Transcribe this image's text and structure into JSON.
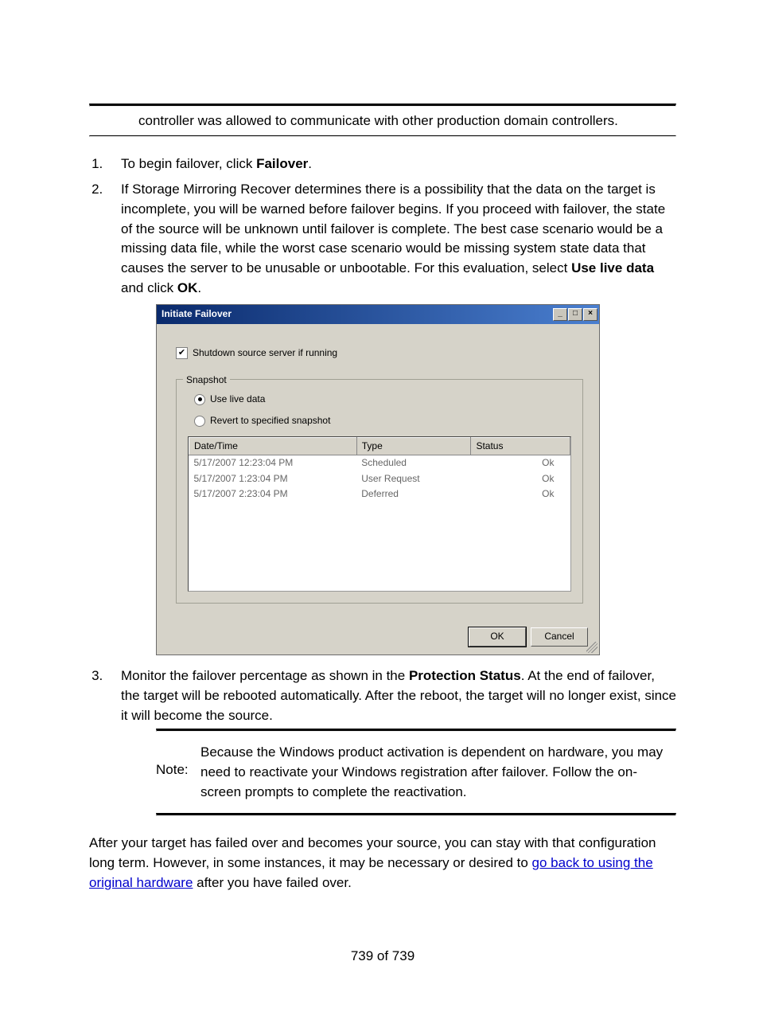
{
  "intro": "controller was allowed to communicate with other production domain controllers.",
  "steps": {
    "s1_a": "To begin failover, click ",
    "s1_bold": "Failover",
    "s1_b": ".",
    "s2_a": "If Storage Mirroring Recover determines there is a possibility that the data on the target is incomplete, you will be warned before failover begins. If you proceed with failover, the state of the source will be unknown until failover is complete. The best case scenario would be a missing data file, while the worst case scenario would be missing system state data that causes the server to be unusable or unbootable. For this evaluation, select ",
    "s2_bold1": "Use live data",
    "s2_mid": " and click ",
    "s2_bold2": "OK",
    "s2_b": ".",
    "s3_a": "Monitor the failover percentage as shown in the ",
    "s3_bold": "Protection Status",
    "s3_b": ". At the end of failover, the target will be rebooted automatically. After the reboot, the target will no longer exist, since it will become the source."
  },
  "dialog": {
    "title": "Initiate Failover",
    "min": "_",
    "max": "□",
    "close": "×",
    "shutdown": "Shutdown source server if running",
    "snapshot_legend": "Snapshot",
    "use_live": "Use live data",
    "revert": "Revert to specified snapshot",
    "cols": {
      "dt": "Date/Time",
      "type": "Type",
      "status": "Status"
    },
    "rows": [
      {
        "dt": "5/17/2007 12:23:04 PM",
        "type": "Scheduled",
        "status": "Ok"
      },
      {
        "dt": "5/17/2007 1:23:04 PM",
        "type": "User Request",
        "status": "Ok"
      },
      {
        "dt": "5/17/2007 2:23:04 PM",
        "type": "Deferred",
        "status": "Ok"
      }
    ],
    "ok": "OK",
    "cancel": "Cancel"
  },
  "note": {
    "label": "Note:",
    "text": "Because the Windows product activation is dependent on hardware, you may need to reactivate your Windows registration after failover. Follow the on-screen prompts to complete the reactivation."
  },
  "after": {
    "a": "After your target has failed over and becomes your source, you can stay with that configuration long term. However, in some instances, it may be necessary or desired to ",
    "link": "go back to using the original hardware",
    "b": " after you have failed over."
  },
  "page_num": "739 of 739"
}
